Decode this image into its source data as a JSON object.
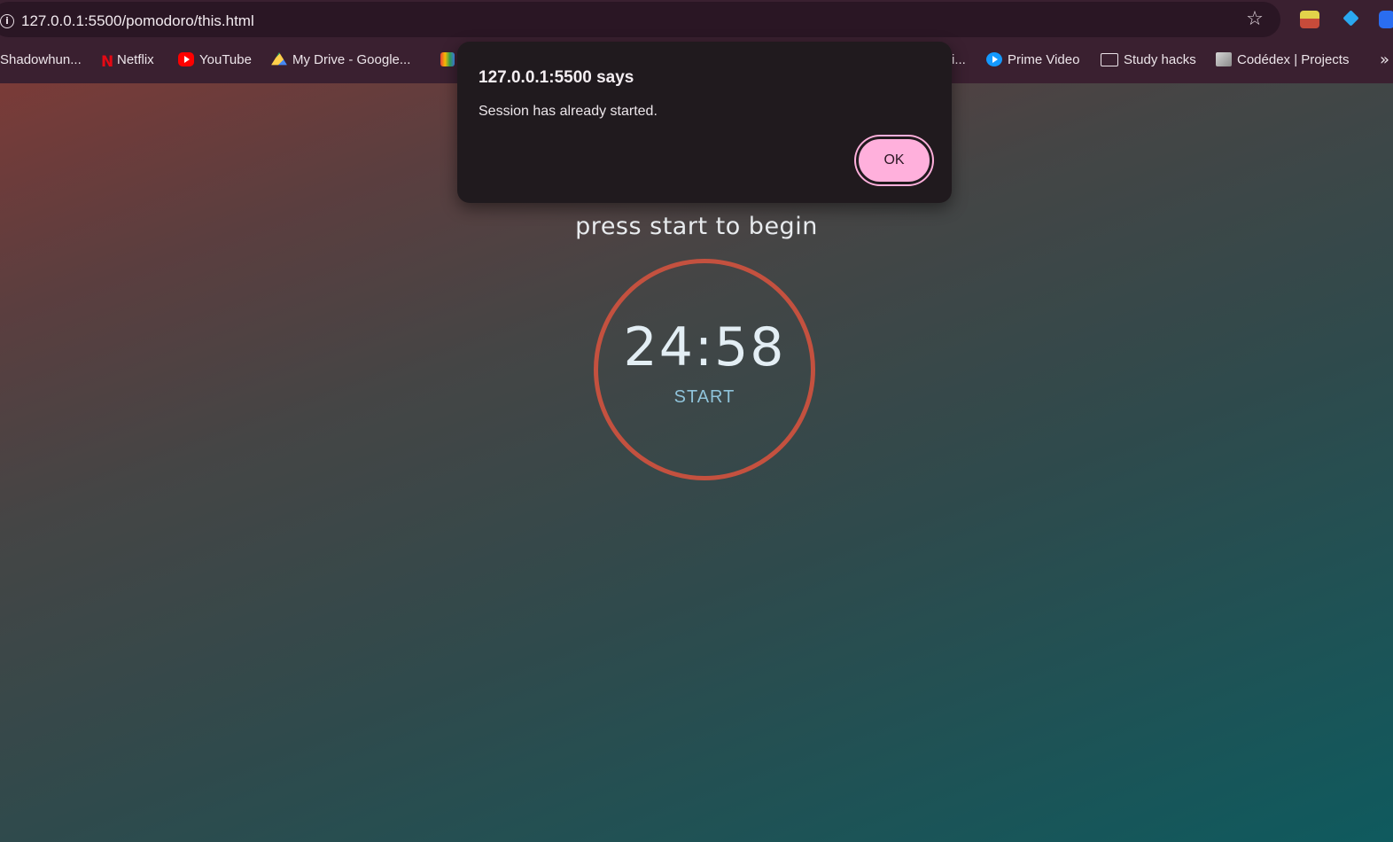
{
  "browser": {
    "url": "127.0.0.1:5500/pomodoro/this.html",
    "bookmarks": [
      {
        "label": "Shadowhun...",
        "icon": "none"
      },
      {
        "label": "Netflix",
        "icon": "netflix-icon"
      },
      {
        "label": "YouTube",
        "icon": "youtube-icon"
      },
      {
        "label": "My Drive - Google...",
        "icon": "google-drive-icon"
      },
      {
        "label": "",
        "icon": "gmail-icon"
      },
      {
        "label": "i...",
        "icon": "none"
      },
      {
        "label": "Prime Video",
        "icon": "prime-video-icon"
      },
      {
        "label": "Study hacks",
        "icon": "folder-icon"
      },
      {
        "label": "Codédex | Projects",
        "icon": "codedex-icon"
      }
    ],
    "more_label": "»"
  },
  "dialog": {
    "title": "127.0.0.1:5500 says",
    "message": "Session has already started.",
    "ok_label": "OK"
  },
  "timer": {
    "prompt": "press start to begin",
    "time": "24:58",
    "start_label": "START"
  },
  "colors": {
    "ring": "#c4513f",
    "ok_button": "#ffb0dc",
    "start_text": "#8fc3da"
  }
}
